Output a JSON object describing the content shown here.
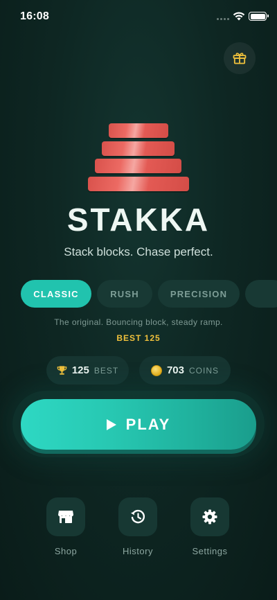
{
  "status_bar": {
    "time": "16:08"
  },
  "app": {
    "title": "STAKKA",
    "tagline": "Stack blocks. Chase perfect."
  },
  "modes": {
    "tabs": [
      {
        "label": "CLASSIC",
        "active": true
      },
      {
        "label": "RUSH",
        "active": false
      },
      {
        "label": "PRECISION",
        "active": false
      },
      {
        "label": "",
        "active": false
      }
    ],
    "description": "The original. Bouncing block, steady ramp.",
    "best_line": "BEST 125"
  },
  "stats": {
    "best_value": "125",
    "best_label": "BEST",
    "coins_value": "703",
    "coins_label": "COINS"
  },
  "play": {
    "label": "PLAY"
  },
  "nav": {
    "shop": "Shop",
    "history": "History",
    "settings": "Settings"
  },
  "colors": {
    "accent": "#21c3ae",
    "block": "#e35a54",
    "gold": "#f0c13c",
    "background": "#0e2723"
  }
}
